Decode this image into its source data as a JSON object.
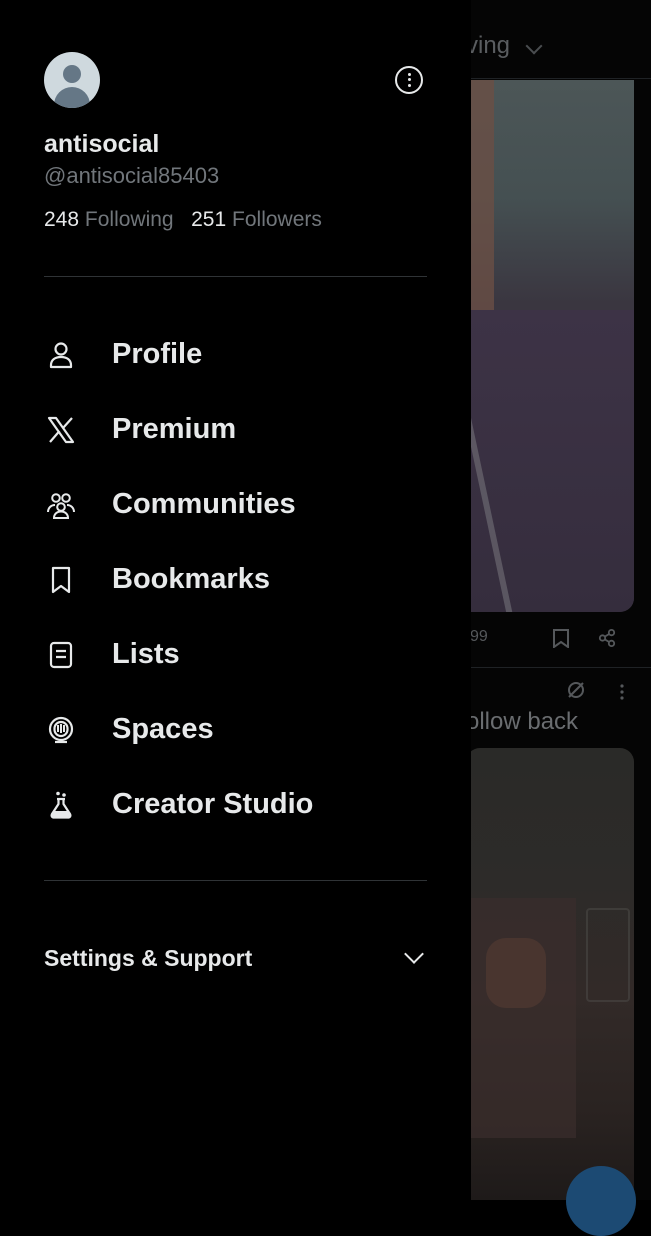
{
  "feed": {
    "tab_fragment": "ving",
    "count_fragment": "99",
    "text_fragment": "ollow back"
  },
  "profile": {
    "display_name": "antisocial",
    "handle": "@antisocial85403",
    "following_count": "248",
    "following_label": "Following",
    "followers_count": "251",
    "followers_label": "Followers"
  },
  "menu": {
    "items": [
      {
        "label": "Profile",
        "icon": "person-icon"
      },
      {
        "label": "Premium",
        "icon": "x-logo-icon"
      },
      {
        "label": "Communities",
        "icon": "communities-icon"
      },
      {
        "label": "Bookmarks",
        "icon": "bookmark-icon"
      },
      {
        "label": "Lists",
        "icon": "list-icon"
      },
      {
        "label": "Spaces",
        "icon": "spaces-icon"
      },
      {
        "label": "Creator Studio",
        "icon": "flask-icon"
      }
    ]
  },
  "settings": {
    "label": "Settings & Support"
  },
  "colors": {
    "background": "#000000",
    "primary_text": "#e7e9ea",
    "secondary_text": "#71767b",
    "divider": "#2f3336"
  }
}
